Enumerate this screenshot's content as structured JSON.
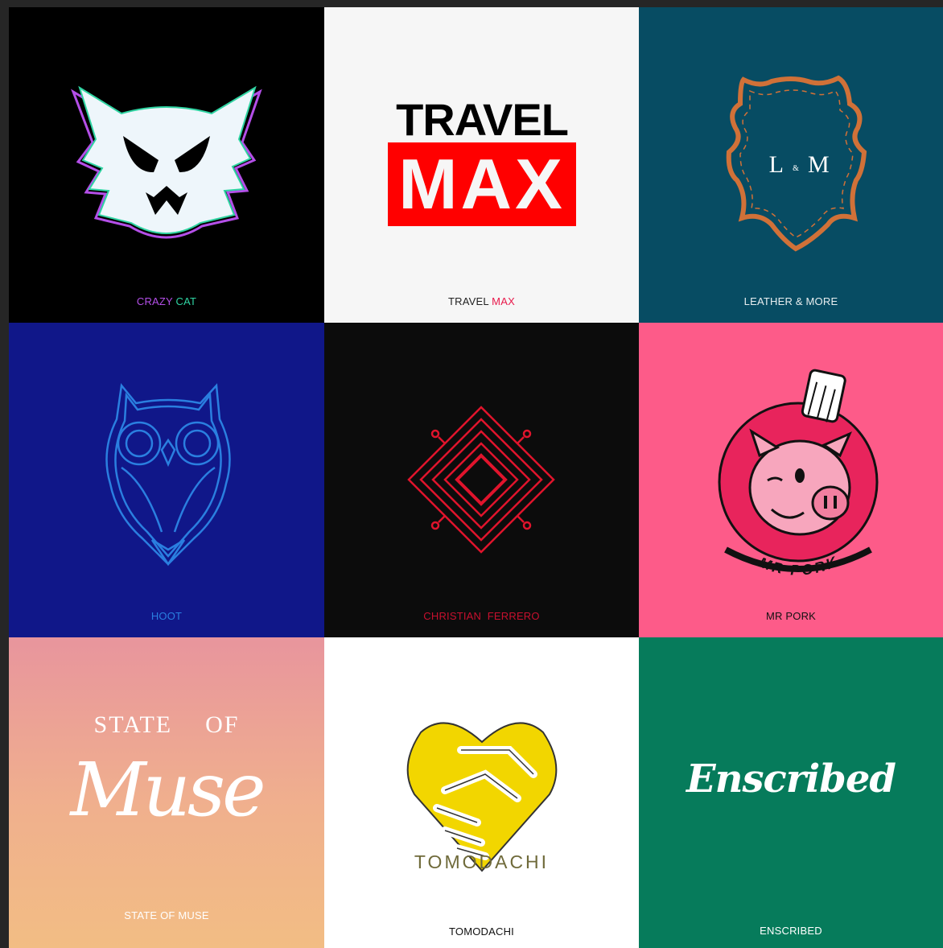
{
  "logos": [
    {
      "caption_a": "CRAZY",
      "caption_b": "CAT",
      "colors": {
        "a": "#b44fe8",
        "b": "#2fd4a2",
        "bg": "#000000"
      }
    },
    {
      "title_top": "TRAVEL",
      "title_bottom": "MAX",
      "caption_a": "TRAVEL",
      "caption_b": "MAX",
      "colors": {
        "a": "#222222",
        "b": "#e8194b",
        "accent": "#ff0000"
      }
    },
    {
      "monogram_left": "L",
      "monogram_mid": "&",
      "monogram_right": "M",
      "caption": "LEATHER & MORE",
      "colors": {
        "accent": "#d07138",
        "bg": "#074c63"
      }
    },
    {
      "caption": "HOOT",
      "colors": {
        "accent": "#2a7fe0",
        "bg": "#101789"
      }
    },
    {
      "caption_a": "CHRISTIAN",
      "caption_b": "FERRERO",
      "colors": {
        "accent": "#e0142c",
        "bg": "#0c0c0c"
      }
    },
    {
      "ring_text": "MR PORK",
      "caption": "MR PORK",
      "colors": {
        "accent": "#e8245c",
        "bg": "#fd5b89"
      }
    },
    {
      "line_1a": "STATE",
      "line_1b": "OF",
      "script": "Muse",
      "caption": "STATE OF MUSE",
      "colors": {
        "text": "#ffffff"
      }
    },
    {
      "wordmark": "TOMODACHI",
      "caption": "TOMODACHI",
      "colors": {
        "accent": "#f2d600",
        "text": "#6f6a3a"
      }
    },
    {
      "script": "Enscribed",
      "caption": "ENSCRIBED",
      "colors": {
        "bg": "#067b5b",
        "text": "#ffffff"
      }
    }
  ]
}
